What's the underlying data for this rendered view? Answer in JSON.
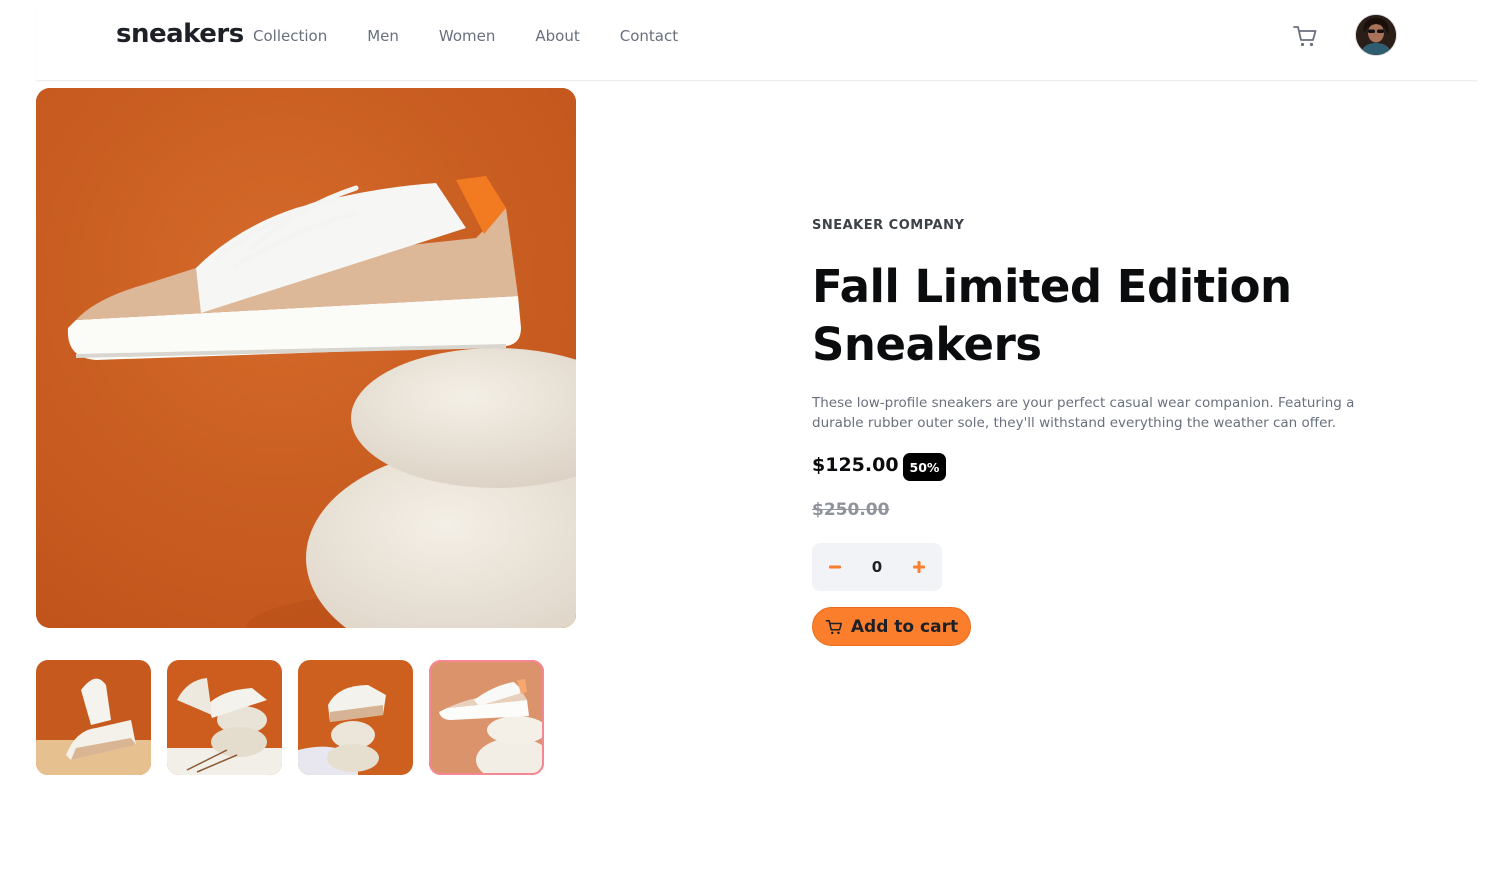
{
  "header": {
    "logo": "sneakers",
    "nav": [
      "Collection",
      "Men",
      "Women",
      "About",
      "Contact"
    ]
  },
  "product": {
    "company": "SNEAKER COMPANY",
    "title_line1": "Fall Limited Edition",
    "title_line2": "Sneakers",
    "description": "These low-profile sneakers are your perfect casual wear companion. Featuring a durable rubber outer sole, they'll withstand everything the weather can offer.",
    "price": "$125.00",
    "discount": "50%",
    "original_price": "$250.00",
    "quantity": "0",
    "add_to_cart": "Add to cart"
  },
  "gallery": {
    "thumbnail_count": 4,
    "active_thumbnail": 4
  },
  "colors": {
    "accent": "#fb7e2d",
    "active_thumb_border": "#f0475a",
    "background_orange": "#c85a1e"
  },
  "icons": {
    "cart": "cart-icon",
    "minus": "minus-icon",
    "plus": "plus-icon"
  }
}
